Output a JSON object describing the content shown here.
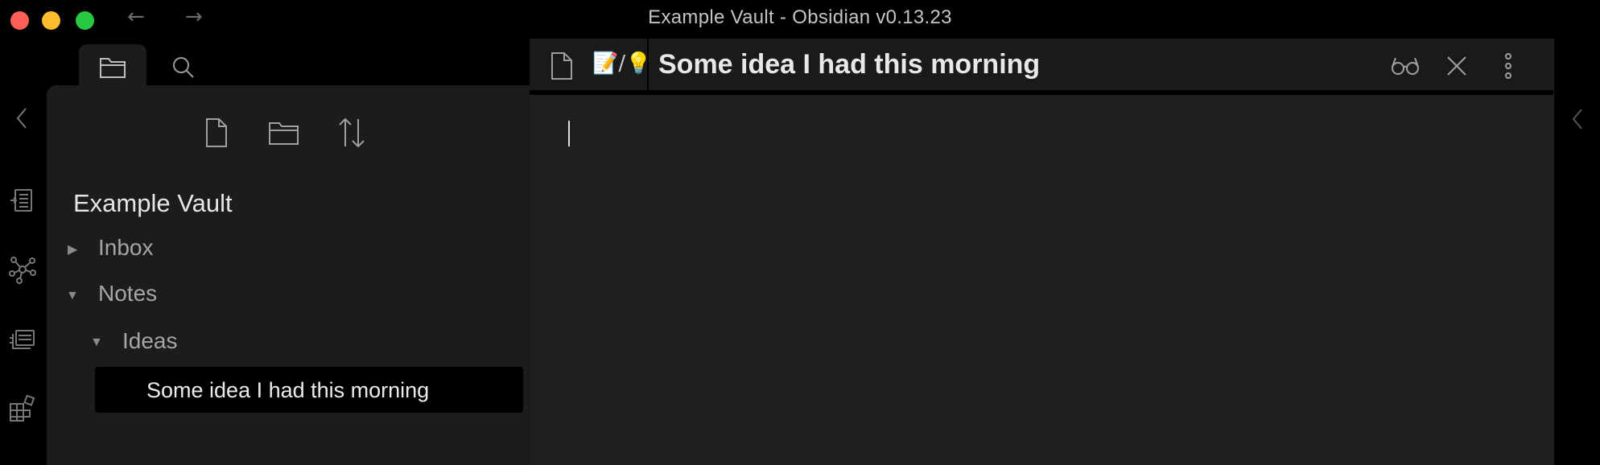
{
  "window": {
    "title": "Example Vault - Obsidian v0.13.23",
    "back_arrow": "←",
    "forward_arrow": "→"
  },
  "ribbon": {
    "items": [
      "collapse-sidebar-icon",
      "file-recovery-icon",
      "graph-view-icon",
      "slides-icon",
      "community-plugins-icon"
    ]
  },
  "sidebar": {
    "tabs": [
      "file-explorer-icon",
      "search-icon"
    ],
    "actions": [
      "new-note-icon",
      "new-folder-icon",
      "sort-icon"
    ],
    "vault_name": "Example Vault",
    "tree": {
      "inbox": "Inbox",
      "notes": "Notes",
      "ideas": "Ideas",
      "selected_note": "Some idea I had this morning"
    }
  },
  "editor": {
    "breadcrumb": "📝/💡",
    "title": "Some idea I had this morning",
    "actions": [
      "reading-view-icon",
      "close-icon",
      "more-options-icon"
    ],
    "content": ""
  },
  "colors": {
    "background": "#000000",
    "sidebar": "#1c1c1c",
    "editor": "#1f1f1f",
    "text": "#dcddde"
  }
}
